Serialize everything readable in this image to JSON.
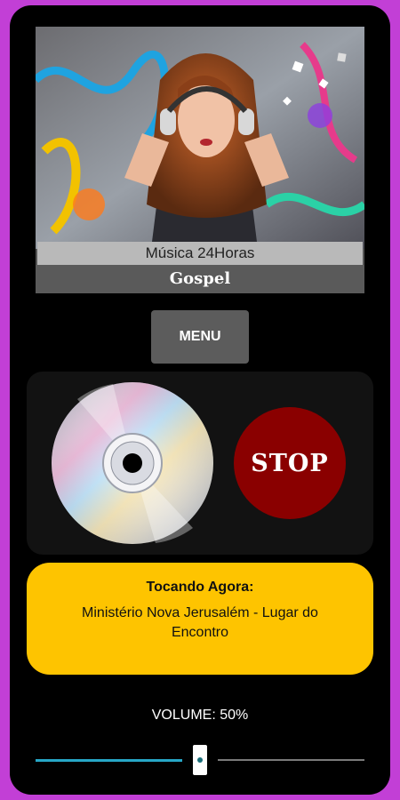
{
  "cover": {
    "station_name": "Música 24Horas",
    "genre": "Gospel"
  },
  "menu": {
    "label": "MENU"
  },
  "player": {
    "stop_label": "STOP"
  },
  "now_playing": {
    "title": "Tocando Agora:",
    "track": "Ministério Nova Jerusalém - Lugar do Encontro"
  },
  "volume": {
    "label": "VOLUME: 50%",
    "value": 0.5
  },
  "colors": {
    "background": "#c23fd6",
    "stop_button": "#8a0000",
    "now_playing_card": "#fec400",
    "slider_fill": "#27a7c7"
  }
}
